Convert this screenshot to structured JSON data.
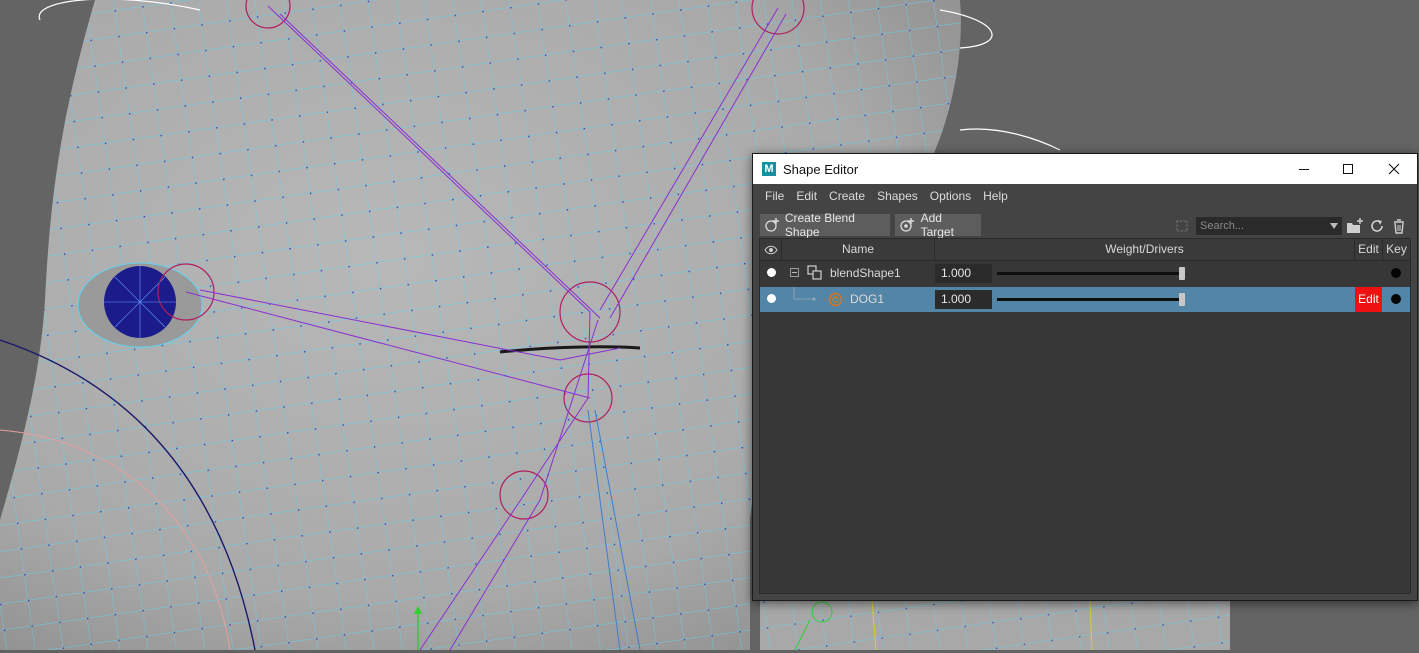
{
  "window": {
    "title": "Shape Editor",
    "app_icon": "maya-icon"
  },
  "menu": [
    "File",
    "Edit",
    "Create",
    "Shapes",
    "Options",
    "Help"
  ],
  "toolbar": {
    "create_blend_shape": "Create Blend Shape",
    "add_target": "Add Target",
    "search_placeholder": "Search..."
  },
  "columns": {
    "name": "Name",
    "weight": "Weight/Drivers",
    "edit": "Edit",
    "key": "Key"
  },
  "rows": [
    {
      "name": "blendShape1",
      "value": "1.000",
      "weight": 1.0,
      "selected": false,
      "type": "blendshape"
    },
    {
      "name": "DOG1",
      "value": "1.000",
      "weight": 1.0,
      "selected": true,
      "type": "target",
      "edit_label": "Edit"
    }
  ],
  "colors": {
    "edit_active": "#ee1111",
    "selection": "#5285a6",
    "wireframe": "#5fd3f0"
  }
}
